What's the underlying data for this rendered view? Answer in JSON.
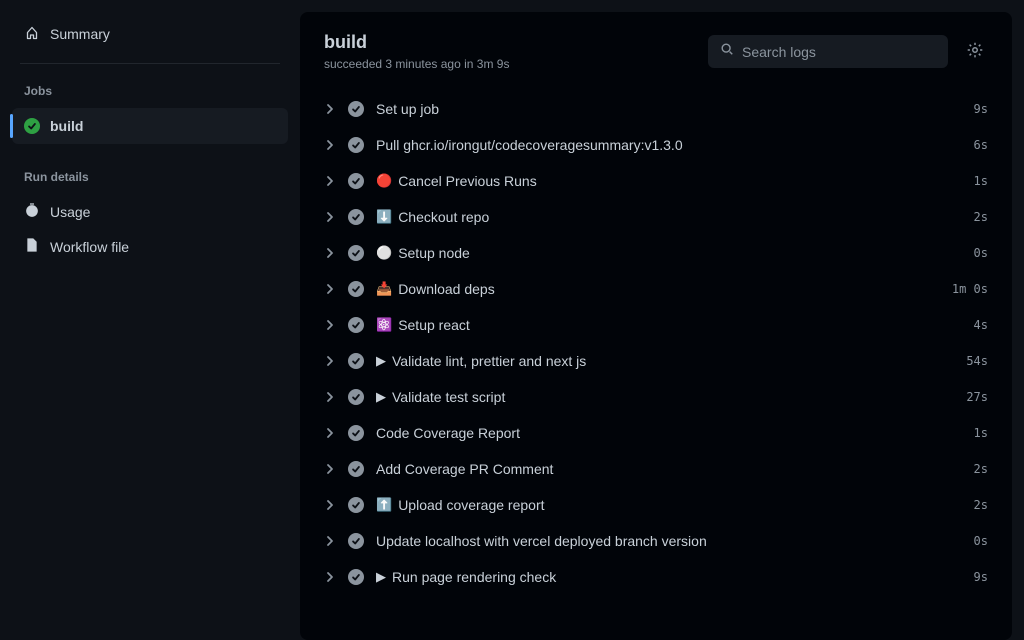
{
  "sidebar": {
    "summary_label": "Summary",
    "jobs_heading": "Jobs",
    "job_name": "build",
    "run_details_heading": "Run details",
    "usage_label": "Usage",
    "workflow_label": "Workflow file"
  },
  "header": {
    "title": "build",
    "status_prefix": "succeeded ",
    "status_time": "3 minutes ago",
    "status_in": " in ",
    "duration": "3m 9s"
  },
  "search": {
    "placeholder": "Search logs"
  },
  "steps": [
    {
      "emoji": "",
      "label": "Set up job",
      "time": "9s"
    },
    {
      "emoji": "",
      "label": "Pull ghcr.io/irongut/codecoveragesummary:v1.3.0",
      "time": "6s"
    },
    {
      "emoji": "🔴",
      "label": "Cancel Previous Runs",
      "time": "1s"
    },
    {
      "emoji": "⬇️",
      "label": "Checkout repo",
      "time": "2s"
    },
    {
      "emoji": "⚪",
      "label": "Setup node",
      "time": "0s"
    },
    {
      "emoji": "📥",
      "label": "Download deps",
      "time": "1m 0s"
    },
    {
      "emoji": "⚛️",
      "label": "Setup react",
      "time": "4s"
    },
    {
      "emoji": "▶",
      "label": "Validate lint, prettier and next js",
      "time": "54s"
    },
    {
      "emoji": "▶",
      "label": "Validate test script",
      "time": "27s"
    },
    {
      "emoji": "",
      "label": "Code Coverage Report",
      "time": "1s"
    },
    {
      "emoji": "",
      "label": "Add Coverage PR Comment",
      "time": "2s"
    },
    {
      "emoji": "⬆️",
      "label": "Upload coverage report",
      "time": "2s"
    },
    {
      "emoji": "",
      "label": "Update localhost with vercel deployed branch version",
      "time": "0s"
    },
    {
      "emoji": "▶",
      "label": "Run page rendering check",
      "time": "9s"
    }
  ]
}
